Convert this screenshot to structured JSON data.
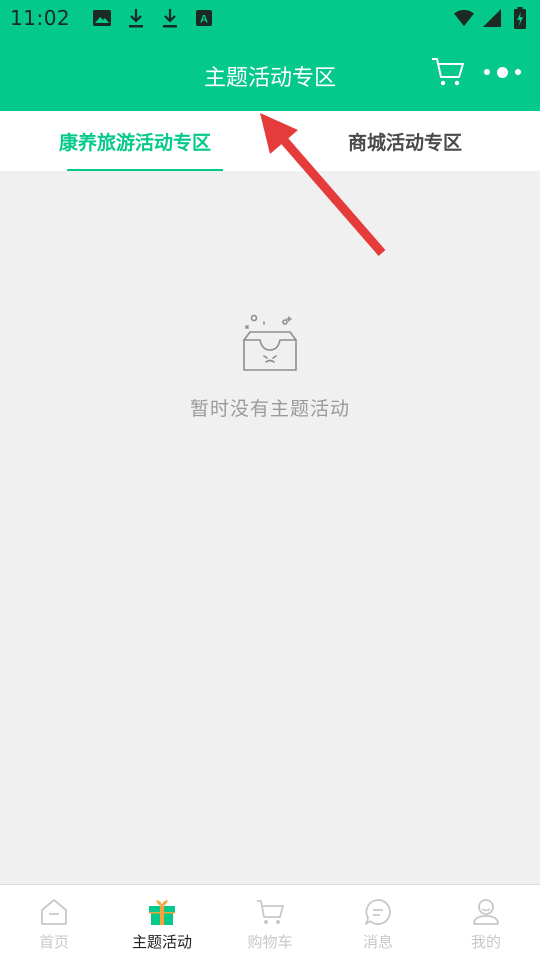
{
  "status_bar": {
    "time": "11:02",
    "left_icons": [
      "image-icon",
      "download-icon",
      "download-icon",
      "app-a-icon"
    ],
    "right_icons": [
      "wifi-icon",
      "signal-icon",
      "battery-charging-icon"
    ]
  },
  "header": {
    "title": "主题活动专区",
    "cart_icon": "cart-icon",
    "more_icon": "more-dots-icon"
  },
  "tabs": [
    {
      "label": "康养旅游活动专区",
      "active": true
    },
    {
      "label": "商城活动专区",
      "active": false
    }
  ],
  "empty_state": {
    "icon": "empty-box-icon",
    "text": "暂时没有主题活动"
  },
  "bottom_nav": [
    {
      "label": "首页",
      "icon": "home-icon",
      "active": false
    },
    {
      "label": "主题活动",
      "icon": "gift-icon",
      "active": true
    },
    {
      "label": "购物车",
      "icon": "cart-icon",
      "active": false
    },
    {
      "label": "消息",
      "icon": "message-icon",
      "active": false
    },
    {
      "label": "我的",
      "icon": "user-icon",
      "active": false
    }
  ],
  "colors": {
    "brand": "#05c98a",
    "annotation": "#e53b3b",
    "inactive_text": "#c8c8c8"
  }
}
